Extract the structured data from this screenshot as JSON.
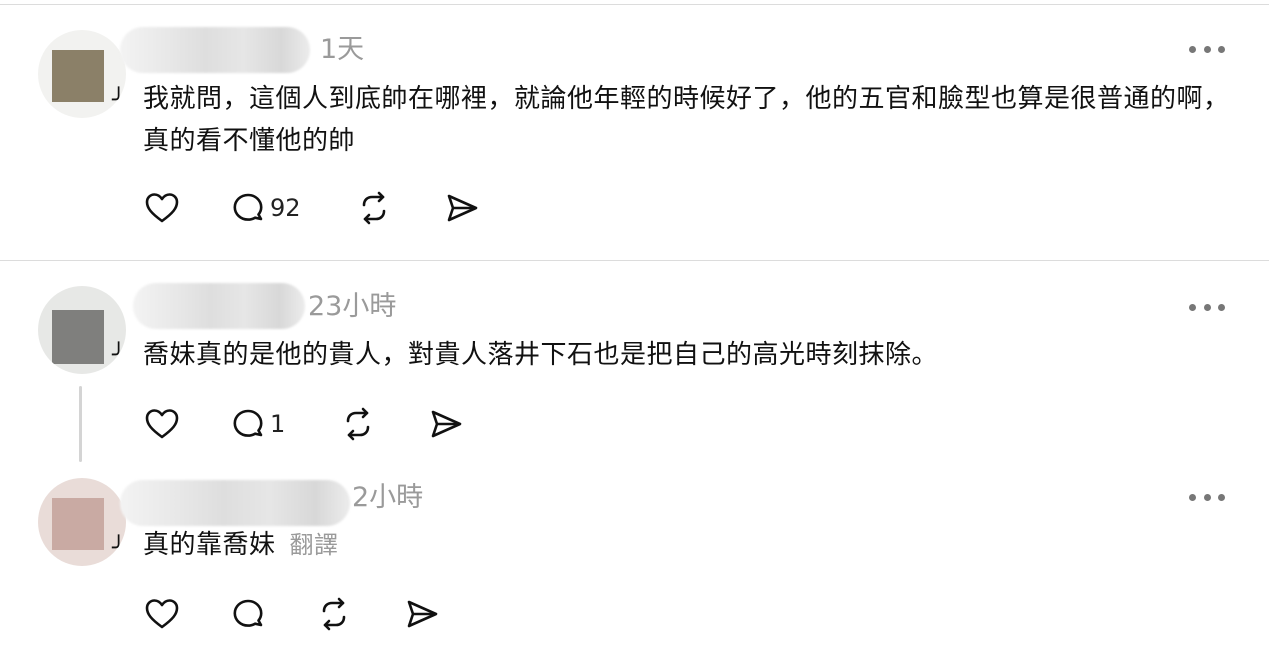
{
  "posts": [
    {
      "time": "1天",
      "text": "我就問，這個人到底帥在哪裡，就論他年輕的時候好了，他的五官和臉型也算是很普通的啊，真的看不懂他的帥",
      "reply_count": "92"
    },
    {
      "time": "23小時",
      "text": "喬妹真的是他的貴人，對貴人落井下石也是把自己的高光時刻抹除。",
      "reply_count": "1"
    },
    {
      "time": "2小時",
      "text": "真的靠喬妹",
      "translate_label": "翻譯",
      "reply_count": ""
    }
  ],
  "icons": {
    "like": "heart-icon",
    "reply": "comment-icon",
    "repost": "repost-icon",
    "share": "send-icon",
    "more": "more-dots-icon"
  },
  "colors": {
    "text": "#111111",
    "muted": "#9a9a9a",
    "divider": "#dcdcdc"
  }
}
